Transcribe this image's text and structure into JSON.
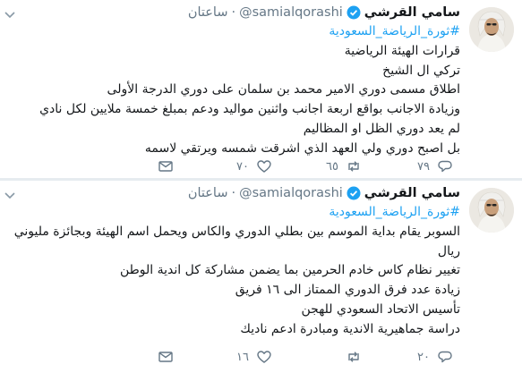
{
  "tweets": [
    {
      "author_name": "سامي القرشي",
      "handle": "@samialqorashi",
      "time": "ساعتان",
      "lines": [
        "#ثورة_الرياضة_السعودية",
        "قرارات الهيئة الرياضية",
        "تركي ال الشيخ",
        "اطلاق مسمى دوري الامير محمد بن سلمان على دوري الدرجة الأولى",
        "وزيادة الاجانب بواقع اربعة اجانب واثنين مواليد ودعم بمبلغ خمسة ملايين لكل نادي",
        "لم يعد دوري الظل او المظاليم",
        "بل اصبح دوري ولي العهد الذي اشرقت شمسه ويرتقي لاسمه"
      ],
      "replies": "٧٩",
      "retweets": "٦٥",
      "likes": "٧٠"
    },
    {
      "author_name": "سامي القرشي",
      "handle": "@samialqorashi",
      "time": "ساعتان",
      "lines": [
        "#ثورة_الرياضة_السعودية",
        "السوبر يقام بداية الموسم بين بطلي الدوري والكاس ويحمل اسم الهيئة وبجائزة مليوني ريال",
        "تغيير نظام كاس خادم الحرمين بما يضمن مشاركة كل اندية الوطن",
        "زيادة عدد فرق الدوري الممتاز الى ١٦ فريق",
        "تأسيس الاتحاد السعودي للهجن",
        "دراسة جماهيرية الاندية ومبادرة ادعم ناديك"
      ],
      "replies": "٢٠",
      "retweets": "",
      "likes": "١٦"
    }
  ],
  "colors": {
    "accent": "#1da1f2",
    "meta": "#657786",
    "text": "#14171a",
    "divider": "#e6ecf0"
  },
  "icons": {
    "reply": "reply-icon",
    "retweet": "retweet-icon",
    "like": "heart-icon",
    "dm": "envelope-icon",
    "verified": "verified-badge-icon",
    "caret": "chevron-down-icon"
  }
}
